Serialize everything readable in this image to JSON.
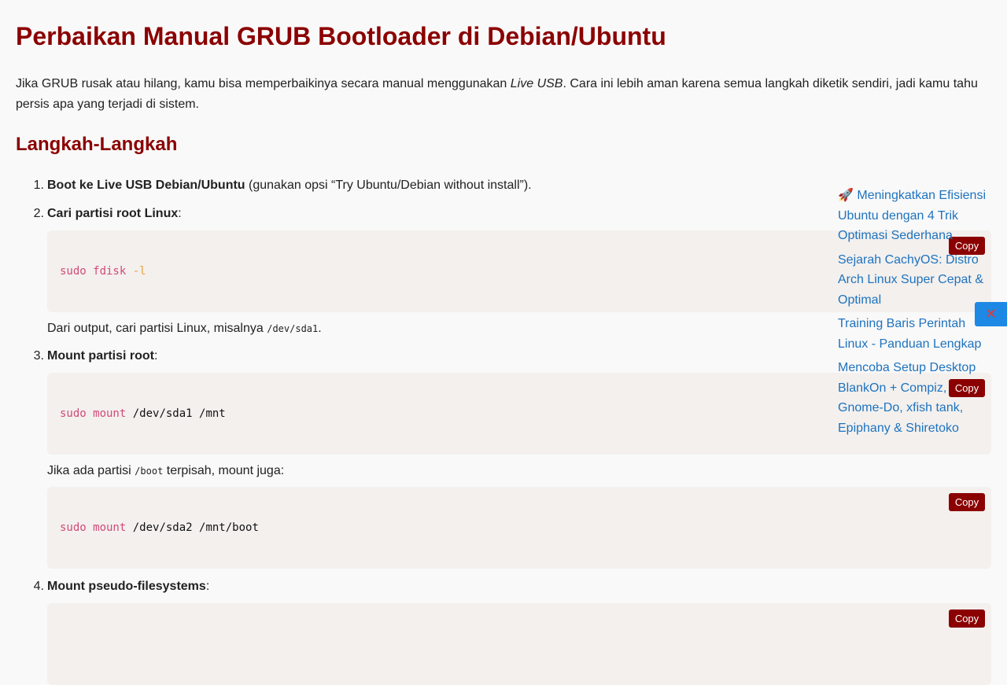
{
  "article": {
    "title": "Perbaikan Manual GRUB Bootloader di Debian/Ubuntu",
    "intro_before": "Jika GRUB rusak atau hilang, kamu bisa memperbaikinya secara manual menggunakan ",
    "intro_em": "Live USB",
    "intro_after": ". Cara ini lebih aman karena semua langkah diketik sendiri, jadi kamu tahu persis apa yang terjadi di sistem.",
    "section_title": "Langkah-Langkah",
    "steps": [
      {
        "num": "1.",
        "bold": "Boot ke Live USB Debian/Ubuntu",
        "rest": " (gunakan opsi “Try Ubuntu/Debian without install”)."
      },
      {
        "num": "2.",
        "bold": "Cari partisi root Linux",
        "rest": ":"
      },
      {
        "num": "3.",
        "bold": "Mount partisi root",
        "rest": ":"
      },
      {
        "num": "4.",
        "bold": "Mount pseudo-filesystems",
        "rest": ":"
      }
    ],
    "code1": {
      "cmd": "sudo fdisk",
      "flag": "-l"
    },
    "para1_before": "Dari output, cari partisi Linux, misalnya ",
    "para1_code": "/dev/sda1",
    "para1_after": ".",
    "code2": {
      "cmd": "sudo mount",
      "args": "/dev/sda1 /mnt"
    },
    "para2_before": "Jika ada partisi ",
    "para2_code": "/boot",
    "para2_after": " terpisah, mount juga:",
    "code3": {
      "cmd": "sudo mount",
      "args": "/dev/sda2 /mnt/boot"
    },
    "copy_label": "Copy"
  },
  "related": {
    "items": [
      "🚀 Meningkatkan Efisiensi Ubuntu dengan 4 Trik Optimasi Sederhana",
      "Sejarah CachyOS: Distro Arch Linux Super Cepat & Optimal",
      "Training Baris Perintah Linux - Panduan Lengkap",
      "Mencoba Setup Desktop BlankOn + Compiz, Gnome-Do, xfish tank, Epiphany & Shiretoko"
    ],
    "close_icon": "✕"
  },
  "colors": {
    "heading": "#8b0000",
    "link": "#1e73be",
    "code_bg": "#f3f0ee",
    "keyword": "#d14b77",
    "flag": "#e8a33b"
  }
}
